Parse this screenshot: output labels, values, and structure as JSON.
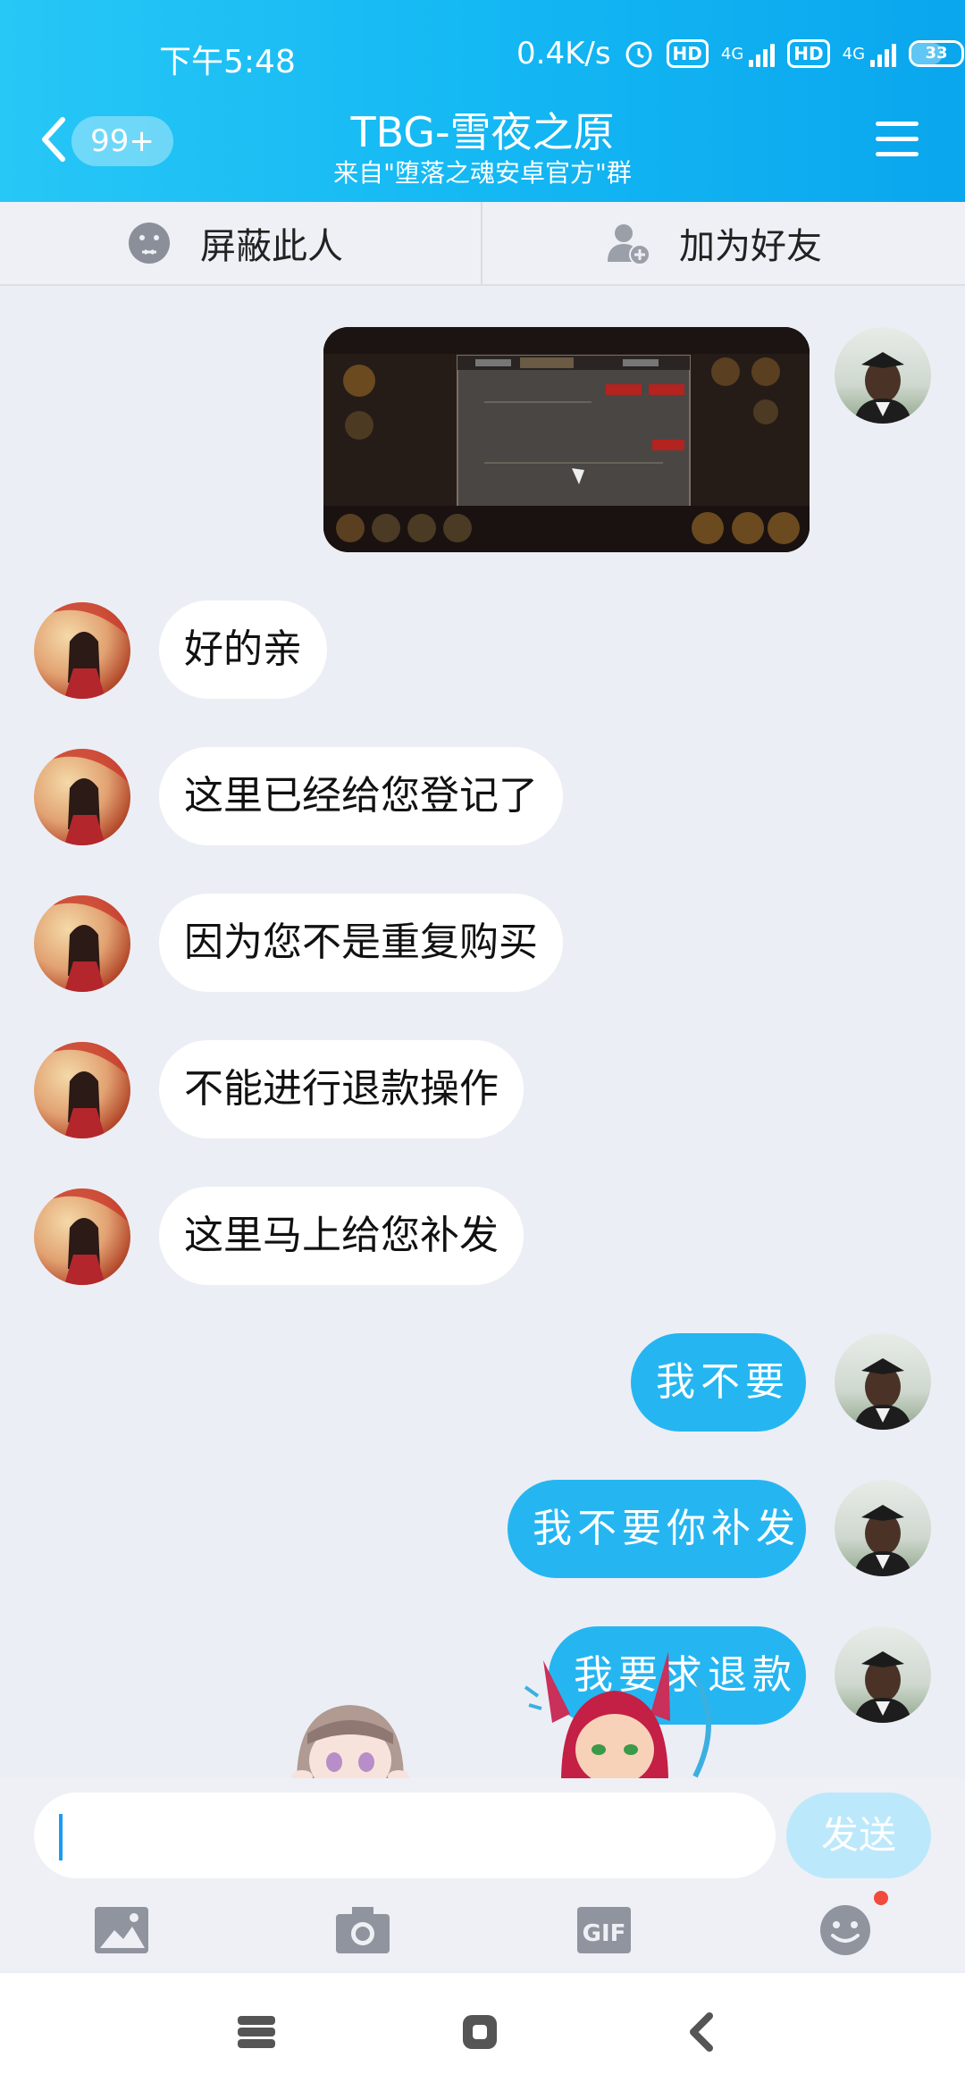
{
  "status_bar": {
    "time": "下午5:48",
    "net_speed": "0.4K/s",
    "hd1": "HD",
    "net1": "4G",
    "hd2": "HD",
    "net2": "4G",
    "battery": "33"
  },
  "header": {
    "unread_count": "99+",
    "title": "TBG-雪夜之原",
    "subtitle": "来自\"堕落之魂安卓官方\"群"
  },
  "actions": {
    "block_label": "屏蔽此人",
    "add_friend_label": "加为好友"
  },
  "messages": [
    {
      "side": "out",
      "type": "image"
    },
    {
      "side": "in",
      "text": "好的亲"
    },
    {
      "side": "in",
      "text": "这里已经给您登记了"
    },
    {
      "side": "in",
      "text": "因为您不是重复购买"
    },
    {
      "side": "in",
      "text": "不能进行退款操作"
    },
    {
      "side": "in",
      "text": "这里马上给您补发"
    },
    {
      "side": "out",
      "text": "我不要"
    },
    {
      "side": "out",
      "text": "我不要你补发"
    },
    {
      "side": "out",
      "text": "我要求退款"
    }
  ],
  "input": {
    "value": "",
    "send_label": "发送"
  },
  "toolbar_icons": [
    "image-icon",
    "camera-icon",
    "gif-icon",
    "emoji-icon"
  ],
  "colors": {
    "header_start": "#27c7f6",
    "header_end": "#0aa6ee",
    "bubble_out": "#25b6f2",
    "bubble_in": "#ffffff",
    "background": "#eceef5",
    "send_button": "#bce8fb",
    "notification_dot": "#f24a3c"
  }
}
